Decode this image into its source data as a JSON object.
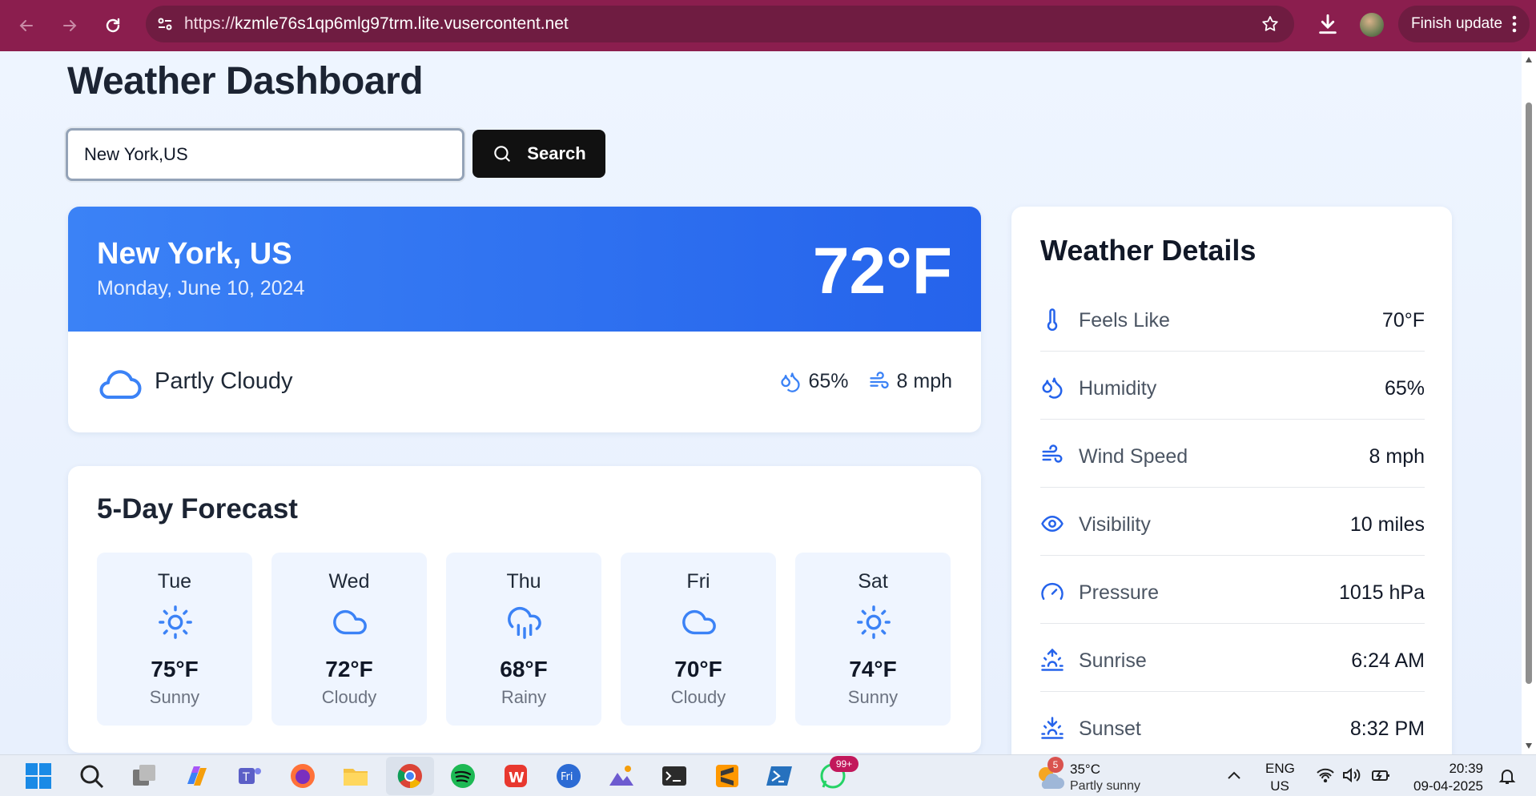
{
  "browser": {
    "url_prefix": "https://",
    "url_domain": "kzmle76s1qp6mlg97trm.lite.vusercontent.net",
    "finish_update_label": "Finish update"
  },
  "page": {
    "title": "Weather Dashboard",
    "search": {
      "value": "New York,US",
      "button_label": "Search"
    }
  },
  "current": {
    "city": "New York, US",
    "date": "Monday, June 10, 2024",
    "temperature": "72°F",
    "condition": "Partly Cloudy",
    "humidity": "65%",
    "wind": "8 mph",
    "condition_icon": "cloud-icon"
  },
  "forecast": {
    "title": "5-Day Forecast",
    "days": [
      {
        "day": "Tue",
        "temp": "75°F",
        "condition": "Sunny",
        "icon": "sun-icon"
      },
      {
        "day": "Wed",
        "temp": "72°F",
        "condition": "Cloudy",
        "icon": "cloud-icon"
      },
      {
        "day": "Thu",
        "temp": "68°F",
        "condition": "Rainy",
        "icon": "rain-icon"
      },
      {
        "day": "Fri",
        "temp": "70°F",
        "condition": "Cloudy",
        "icon": "cloud-icon"
      },
      {
        "day": "Sat",
        "temp": "74°F",
        "condition": "Sunny",
        "icon": "sun-icon"
      }
    ]
  },
  "details": {
    "title": "Weather Details",
    "rows": [
      {
        "label": "Feels Like",
        "value": "70°F",
        "icon": "thermometer-icon"
      },
      {
        "label": "Humidity",
        "value": "65%",
        "icon": "droplets-icon"
      },
      {
        "label": "Wind Speed",
        "value": "8 mph",
        "icon": "wind-icon"
      },
      {
        "label": "Visibility",
        "value": "10 miles",
        "icon": "eye-icon"
      },
      {
        "label": "Pressure",
        "value": "1015 hPa",
        "icon": "gauge-icon"
      },
      {
        "label": "Sunrise",
        "value": "6:24 AM",
        "icon": "sunrise-icon"
      },
      {
        "label": "Sunset",
        "value": "8:32 PM",
        "icon": "sunset-icon"
      }
    ]
  },
  "taskbar": {
    "weather_temp": "35°C",
    "weather_condition": "Partly sunny",
    "weather_badge": "5",
    "whatsapp_badge": "99+",
    "lang_top": "ENG",
    "lang_bottom": "US",
    "time": "20:39",
    "date": "09-04-2025"
  },
  "colors": {
    "browser_frame": "#8b1e4e",
    "accent_blue": "#3b82f6",
    "icon_blue": "#2563eb",
    "page_bg": "#eef4fd"
  }
}
